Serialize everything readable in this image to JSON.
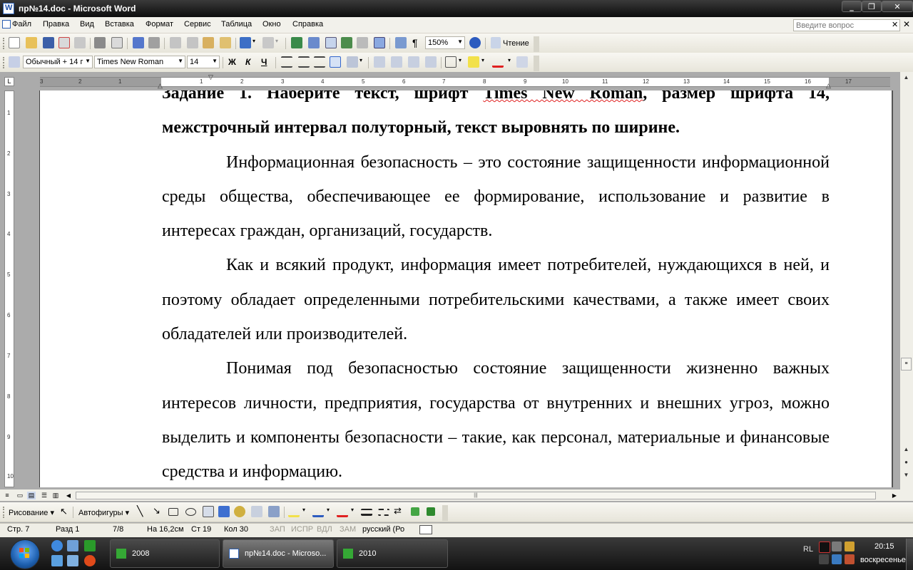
{
  "window": {
    "title": "пр№14.doc - Microsoft Word",
    "minimize": "_",
    "maximize": "❐",
    "close": "✕"
  },
  "menu": {
    "items": [
      "Файл",
      "Правка",
      "Вид",
      "Вставка",
      "Формат",
      "Сервис",
      "Таблица",
      "Окно",
      "Справка"
    ],
    "ask_placeholder": "Введите вопрос",
    "ask_close": "✕",
    "close": "✕"
  },
  "toolbar_standard": {
    "zoom": "150%",
    "reading": "Чтение"
  },
  "toolbar_format": {
    "style": "Обычный + 14 г",
    "font": "Times New Roman",
    "size": "14",
    "bold": "Ж",
    "italic": "К",
    "underline": "Ч"
  },
  "ruler": {
    "corner": "L",
    "ticks": [
      "3",
      "2",
      "1",
      "1",
      "2",
      "3",
      "4",
      "5",
      "6",
      "7",
      "8",
      "9",
      "10",
      "11",
      "12",
      "13",
      "14",
      "15",
      "16",
      "17"
    ],
    "vticks": [
      "1",
      "2",
      "3",
      "4",
      "5",
      "6",
      "7",
      "8",
      "9",
      "10"
    ]
  },
  "document": {
    "heading_part1": "Задание 1. Наберите текст, шрифт ",
    "heading_squig": "Times New Roman",
    "heading_part2": ", размер шрифта 14, межстрочный интервал полуторный, текст выровнять по ширине.",
    "paragraphs": [
      "Информационная безопасность – это состояние защищенности информационной среды общества, обеспечивающее ее формирование, использование и развитие в интересах граждан, организаций, государств.",
      "Как и всякий продукт, информация имеет потребителей, нуждающихся в ней, и поэтому обладает определенными потребительскими качествами, а также имеет своих обладателей или производителей.",
      "Понимая под безопасностью состояние защищенности жизненно важных интересов личности, предприятия, государства от внутренних и внешних угроз, можно выделить и компоненты безопасности – такие, как персонал, материальные и финансовые средства и информацию."
    ]
  },
  "drawing_toolbar": {
    "draw": "Рисование ▾",
    "autoshapes": "Автофигуры ▾"
  },
  "status": {
    "page": "Стр. 7",
    "section": "Разд 1",
    "pages": "7/8",
    "at": "На 16,2см",
    "line": "Ст 19",
    "col": "Кол 30",
    "rec": "ЗАП",
    "trk": "ИСПР",
    "ext": "ВДЛ",
    "ovr": "ЗАМ",
    "lang": "русский (Ро"
  },
  "taskbar": {
    "tasks": [
      "2008",
      "пр№14.doc - Microso...",
      "2010"
    ],
    "lang_indicator": "RL",
    "time": "20:15",
    "day": "воскресенье"
  },
  "colors": {
    "title_bar": "#0d0d0d",
    "menu_bg": "#f2f1eb",
    "page_bg": "#ffffff",
    "workspace": "#ababab",
    "taskbar": "#1c1c1c"
  }
}
